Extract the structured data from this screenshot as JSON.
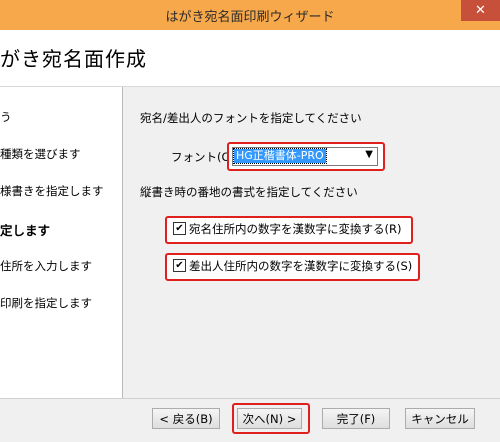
{
  "window": {
    "title": "はがき宛名面印刷ウィザード",
    "close_label": "✕"
  },
  "header": {
    "title": "がき宛名面作成"
  },
  "sidebar": {
    "items": [
      {
        "label": "う"
      },
      {
        "label": "種類を選びます"
      },
      {
        "label": "様書きを指定します"
      },
      {
        "label": "定します"
      },
      {
        "label": "住所を入力します"
      },
      {
        "label": "印刷を指定します"
      }
    ]
  },
  "main": {
    "font_section_label": "宛名/差出人のフォントを指定してください",
    "font_label": "フォント(O):",
    "font_value": "HG正楷書体-PRO",
    "vertical_section_label": "縦書き時の番地の書式を指定してください",
    "checkbox1": {
      "label": "宛名住所内の数字を漢数字に変換する(R)",
      "checked": true
    },
    "checkbox2": {
      "label": "差出人住所内の数字を漢数字に変換する(S)",
      "checked": true
    }
  },
  "footer": {
    "back_label": "< 戻る(B)",
    "next_label": "次へ(N) >",
    "finish_label": "完了(F)",
    "cancel_label": "キャンセル"
  },
  "colors": {
    "highlight": "#e0201c",
    "selection": "#3399ff",
    "titlebar": "#f7a84a"
  }
}
